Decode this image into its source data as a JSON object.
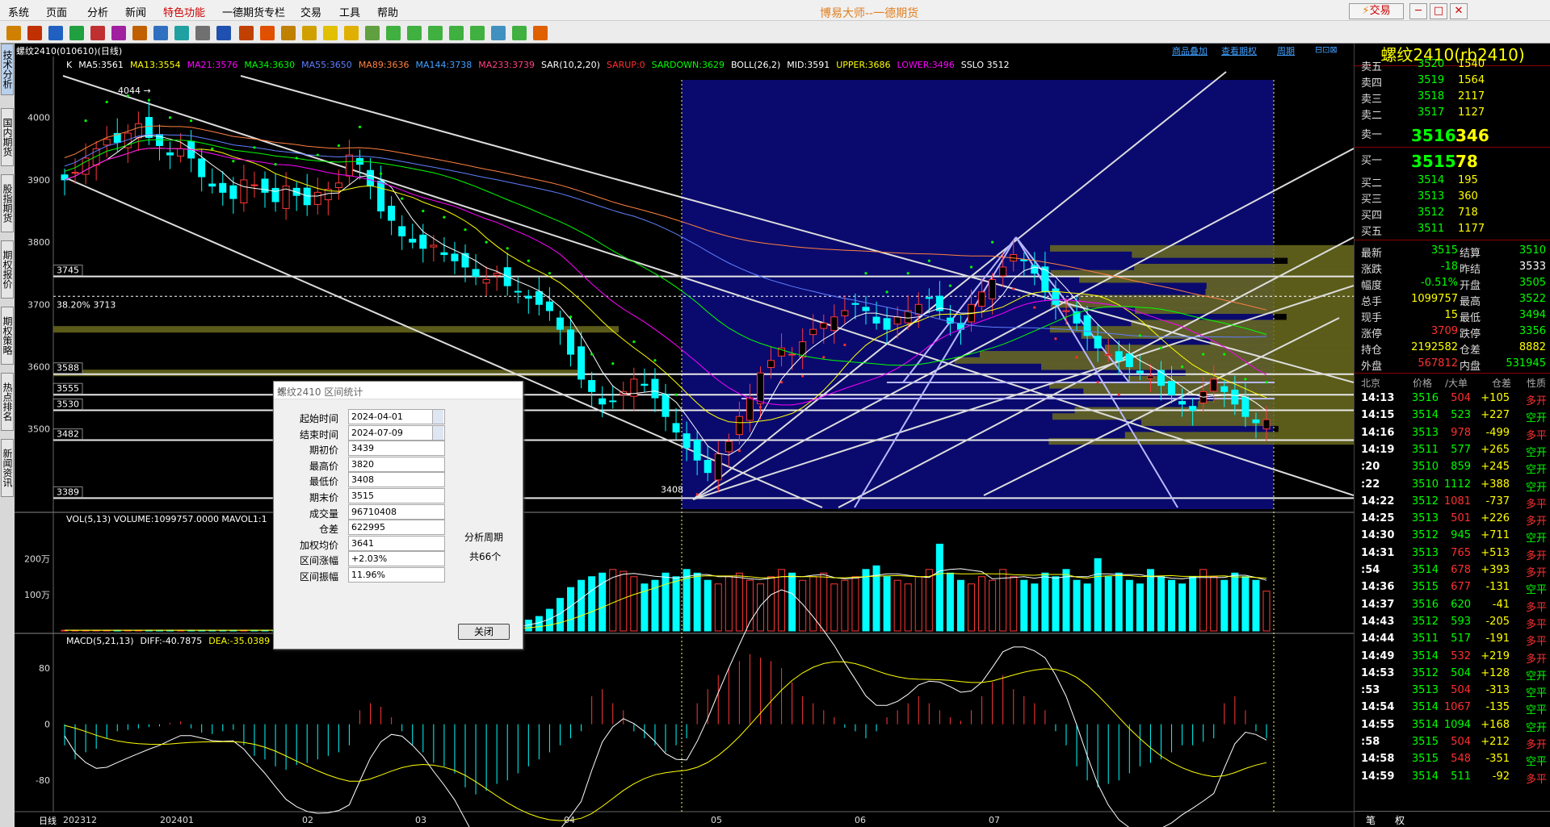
{
  "menu": [
    "系统",
    "页面",
    "分析",
    "新闻",
    "特色功能",
    "一德期货专栏",
    "交易",
    "工具",
    "帮助"
  ],
  "app_title": "博易大师--一德期货",
  "trade_label": "交易",
  "sub_window": "螺纹2410(010610)(日线)",
  "topright_links": [
    "商品叠加",
    "查看期权",
    "周期"
  ],
  "left_tabs": [
    "技术分析",
    "国内期货",
    "股指期货",
    "期权报价",
    "期权策略",
    "热点排名",
    "新闻资讯"
  ],
  "kline_indicators": [
    {
      "text": "K",
      "color": "#ffffff"
    },
    {
      "text": "MA5:3561",
      "color": "#ffffff"
    },
    {
      "text": "MA13:3554",
      "color": "#ffff00"
    },
    {
      "text": "MA21:3576",
      "color": "#ff00ff"
    },
    {
      "text": "MA34:3630",
      "color": "#00ff00"
    },
    {
      "text": "MA55:3650",
      "color": "#5f7fff"
    },
    {
      "text": "MA89:3636",
      "color": "#ff8040"
    },
    {
      "text": "MA144:3738",
      "color": "#40a0ff"
    },
    {
      "text": "MA233:3739",
      "color": "#ff4080"
    },
    {
      "text": "SAR(10,2,20)",
      "color": "#ffffff"
    },
    {
      "text": "SARUP:0",
      "color": "#ff3030"
    },
    {
      "text": "SARDOWN:3629",
      "color": "#00ff00"
    },
    {
      "text": "BOLL(26,2)",
      "color": "#ffffff"
    },
    {
      "text": "MID:3591",
      "color": "#ffffff"
    },
    {
      "text": "UPPER:3686",
      "color": "#ffff00"
    },
    {
      "text": "LOWER:3496",
      "color": "#ff00ff"
    },
    {
      "text": "SSLO 3512",
      "color": "#ffffff"
    }
  ],
  "vol_header": "VOL(5,13) VOLUME:1099757.0000  MAVOL1:1",
  "macd_header_parts": [
    {
      "text": "MACD(5,21,13)",
      "color": "#ffffff"
    },
    {
      "text": "DIFF:-40.7875",
      "color": "#ffffff"
    },
    {
      "text": "DEA:-35.0389",
      "color": "#ffff00"
    },
    {
      "text": "M",
      "color": "#ffffff"
    }
  ],
  "chart_data": [
    {
      "type": "candlestick",
      "name": "K线",
      "y_ticks": [
        4000,
        3900,
        3800,
        3700,
        3600,
        3500
      ],
      "ylim": [
        3370,
        4080
      ],
      "marked_levels": [
        3745,
        3588,
        3555,
        3530,
        3482,
        3389
      ],
      "fib_label": "38.20% 3713",
      "high_label": "4044",
      "low_label": "3408",
      "x_ticks": [
        "202312",
        "202401",
        "02",
        "03",
        "04",
        "05",
        "06",
        "07"
      ],
      "close_series": [
        3900,
        3912,
        3935,
        3950,
        3965,
        3960,
        3975,
        3990,
        3968,
        3955,
        3940,
        3950,
        3935,
        3905,
        3890,
        3880,
        3870,
        3900,
        3892,
        3880,
        3865,
        3890,
        3875,
        3860,
        3880,
        3885,
        3895,
        3940,
        3925,
        3890,
        3850,
        3835,
        3810,
        3800,
        3790,
        3795,
        3780,
        3770,
        3760,
        3745,
        3740,
        3750,
        3730,
        3720,
        3710,
        3700,
        3690,
        3660,
        3620,
        3580,
        3560,
        3540,
        3545,
        3560,
        3580,
        3570,
        3550,
        3520,
        3495,
        3470,
        3450,
        3430,
        3460,
        3480,
        3520,
        3550,
        3590,
        3610,
        3630,
        3620,
        3640,
        3660,
        3670,
        3680,
        3690,
        3700,
        3690,
        3670,
        3660,
        3680,
        3690,
        3700,
        3710,
        3690,
        3670,
        3660,
        3700,
        3720,
        3740,
        3760,
        3780,
        3770,
        3750,
        3720,
        3700,
        3690,
        3670,
        3650,
        3630,
        3620,
        3610,
        3600,
        3590,
        3585,
        3570,
        3555,
        3540,
        3530,
        3560,
        3580,
        3560,
        3540,
        3520,
        3510,
        3515
      ]
    },
    {
      "type": "bar",
      "name": "VOL",
      "y_ticks": [
        "200万",
        "100万"
      ],
      "tick_values": [
        200,
        100
      ],
      "ylim": [
        0,
        290
      ],
      "values": [
        2,
        2,
        2,
        2,
        2,
        2,
        2,
        2,
        2,
        2,
        2,
        2,
        2,
        2,
        2,
        2,
        2,
        2,
        2,
        2,
        2,
        2,
        2,
        2,
        2,
        2,
        2,
        2,
        2,
        2,
        3,
        3,
        3,
        3,
        4,
        4,
        4,
        5,
        6,
        6,
        8,
        10,
        14,
        20,
        30,
        40,
        60,
        90,
        120,
        140,
        150,
        160,
        170,
        165,
        150,
        130,
        140,
        160,
        150,
        170,
        160,
        140,
        130,
        150,
        160,
        140,
        130,
        150,
        170,
        160,
        140,
        150,
        160,
        130,
        140,
        150,
        170,
        180,
        150,
        140,
        130,
        150,
        170,
        240,
        160,
        140,
        130,
        150,
        140,
        170,
        150,
        140,
        130,
        160,
        150,
        170,
        140,
        130,
        200,
        150,
        160,
        140,
        130,
        170,
        150,
        140,
        130,
        150,
        170,
        150,
        140,
        160,
        150,
        140,
        110
      ]
    },
    {
      "type": "bar",
      "name": "MACD",
      "y_ticks": [
        80,
        0,
        -80
      ],
      "ylim": [
        -120,
        110
      ],
      "values": [
        -30,
        -50,
        -40,
        -35,
        -20,
        -10,
        -8,
        -6,
        -4,
        -3,
        2,
        4,
        -6,
        -12,
        -14,
        -10,
        -8,
        -30,
        -45,
        -50,
        -60,
        -65,
        -58,
        -55,
        -50,
        -45,
        -40,
        -30,
        20,
        30,
        25,
        10,
        -10,
        -30,
        -40,
        -55,
        -60,
        -70,
        -90,
        -100,
        -95,
        -85,
        -80,
        -70,
        -60,
        -50,
        -40,
        -30,
        -20,
        -10,
        40,
        50,
        30,
        20,
        -10,
        -20,
        -30,
        -40,
        -30,
        -20,
        30,
        50,
        70,
        80,
        90,
        100,
        95,
        90,
        80,
        60,
        40,
        30,
        20,
        10,
        -5,
        -10,
        -20,
        -10,
        10,
        20,
        30,
        40,
        30,
        20,
        10,
        5,
        20,
        40,
        60,
        70,
        50,
        40,
        30,
        20,
        -10,
        -30,
        -60,
        -80,
        -90,
        -85,
        -80,
        -70,
        -60,
        -55,
        -50,
        -40,
        -30,
        -30,
        -25,
        -20,
        30,
        40,
        20,
        -10,
        -20
      ]
    }
  ],
  "panel": {
    "title": "螺纹2410(rb2410)",
    "asks": [
      {
        "label": "卖五",
        "price": "3520",
        "vol": "1540"
      },
      {
        "label": "卖四",
        "price": "3519",
        "vol": "1564"
      },
      {
        "label": "卖三",
        "price": "3518",
        "vol": "2117"
      },
      {
        "label": "卖二",
        "price": "3517",
        "vol": "1127"
      },
      {
        "label": "卖一",
        "price": "3516",
        "vol": "346"
      }
    ],
    "bids": [
      {
        "label": "买一",
        "price": "3515",
        "vol": "78"
      },
      {
        "label": "买二",
        "price": "3514",
        "vol": "195"
      },
      {
        "label": "买三",
        "price": "3513",
        "vol": "360"
      },
      {
        "label": "买四",
        "price": "3512",
        "vol": "718"
      },
      {
        "label": "买五",
        "price": "3511",
        "vol": "1177"
      }
    ],
    "stats": [
      {
        "l1": "最新",
        "v1": "3515",
        "c1": "#00ff00",
        "l2": "结算",
        "v2": "3510",
        "c2": "#00ff00"
      },
      {
        "l1": "涨跌",
        "v1": "-18",
        "c1": "#00ff00",
        "l2": "昨结",
        "v2": "3533",
        "c2": "#ffffff"
      },
      {
        "l1": "幅度",
        "v1": "-0.51%",
        "c1": "#00ff00",
        "l2": "开盘",
        "v2": "3505",
        "c2": "#00ff00"
      },
      {
        "l1": "总手",
        "v1": "1099757",
        "c1": "#ffff00",
        "l2": "最高",
        "v2": "3522",
        "c2": "#00ff00"
      },
      {
        "l1": "现手",
        "v1": "15",
        "c1": "#ffff00",
        "l2": "最低",
        "v2": "3494",
        "c2": "#00ff00"
      },
      {
        "l1": "涨停",
        "v1": "3709",
        "c1": "#ff3030",
        "l2": "跌停",
        "v2": "3356",
        "c2": "#00ff00"
      },
      {
        "l1": "持仓",
        "v1": "2192582",
        "c1": "#ffff00",
        "l2": "仓差",
        "v2": "8882",
        "c2": "#ffff00"
      },
      {
        "l1": "外盘",
        "v1": "567812",
        "c1": "#ff3030",
        "l2": "内盘",
        "v2": "531945",
        "c2": "#00ff00"
      }
    ],
    "tick_headers": [
      "北京",
      "价格",
      "∕大单",
      "仓差",
      "性质"
    ],
    "ticks": [
      {
        "t": "14:13",
        "p": "3516",
        "v": "504",
        "d": "+105",
        "n": "多开",
        "vc": "#ff3030",
        "nc": "#ff3030"
      },
      {
        "t": "14:15",
        "p": "3514",
        "v": "523",
        "d": "+227",
        "n": "空开",
        "vc": "#00ff00",
        "nc": "#00ff00"
      },
      {
        "t": "14:16",
        "p": "3513",
        "v": "978",
        "d": "-499",
        "n": "多平",
        "vc": "#ff3030",
        "nc": "#ff3030"
      },
      {
        "t": "14:19",
        "p": "3511",
        "v": "577",
        "d": "+265",
        "n": "空开",
        "vc": "#00ff00",
        "nc": "#00ff00"
      },
      {
        "t": ":20",
        "p": "3510",
        "v": "859",
        "d": "+245",
        "n": "空开",
        "vc": "#00ff00",
        "nc": "#00ff00"
      },
      {
        "t": ":22",
        "p": "3510",
        "v": "1112",
        "d": "+388",
        "n": "空开",
        "vc": "#00ff00",
        "nc": "#00ff00"
      },
      {
        "t": "14:22",
        "p": "3512",
        "v": "1081",
        "d": "-737",
        "n": "多平",
        "vc": "#ff3030",
        "nc": "#ff3030"
      },
      {
        "t": "14:25",
        "p": "3513",
        "v": "501",
        "d": "+226",
        "n": "多开",
        "vc": "#ff3030",
        "nc": "#ff3030"
      },
      {
        "t": "14:30",
        "p": "3512",
        "v": "945",
        "d": "+711",
        "n": "空开",
        "vc": "#00ff00",
        "nc": "#00ff00"
      },
      {
        "t": "14:31",
        "p": "3513",
        "v": "765",
        "d": "+513",
        "n": "多开",
        "vc": "#ff3030",
        "nc": "#ff3030"
      },
      {
        "t": ":54",
        "p": "3514",
        "v": "678",
        "d": "+393",
        "n": "多开",
        "vc": "#ff3030",
        "nc": "#ff3030"
      },
      {
        "t": "14:36",
        "p": "3515",
        "v": "677",
        "d": "-131",
        "n": "空平",
        "vc": "#ff3030",
        "nc": "#00ff00"
      },
      {
        "t": "14:37",
        "p": "3516",
        "v": "620",
        "d": "-41",
        "n": "多平",
        "vc": "#00ff00",
        "nc": "#ff3030"
      },
      {
        "t": "14:43",
        "p": "3512",
        "v": "593",
        "d": "-205",
        "n": "多平",
        "vc": "#00ff00",
        "nc": "#ff3030"
      },
      {
        "t": "14:44",
        "p": "3511",
        "v": "517",
        "d": "-191",
        "n": "多平",
        "vc": "#00ff00",
        "nc": "#ff3030"
      },
      {
        "t": "14:49",
        "p": "3514",
        "v": "532",
        "d": "+219",
        "n": "多开",
        "vc": "#ff3030",
        "nc": "#ff3030"
      },
      {
        "t": "14:53",
        "p": "3512",
        "v": "504",
        "d": "+128",
        "n": "空开",
        "vc": "#00ff00",
        "nc": "#00ff00"
      },
      {
        "t": ":53",
        "p": "3513",
        "v": "504",
        "d": "-313",
        "n": "空平",
        "vc": "#ff3030",
        "nc": "#00ff00"
      },
      {
        "t": "14:54",
        "p": "3514",
        "v": "1067",
        "d": "-135",
        "n": "空平",
        "vc": "#ff3030",
        "nc": "#00ff00"
      },
      {
        "t": "14:55",
        "p": "3514",
        "v": "1094",
        "d": "+168",
        "n": "空开",
        "vc": "#00ff00",
        "nc": "#00ff00"
      },
      {
        "t": ":58",
        "p": "3515",
        "v": "504",
        "d": "+212",
        "n": "多开",
        "vc": "#ff3030",
        "nc": "#ff3030"
      },
      {
        "t": "14:58",
        "p": "3515",
        "v": "548",
        "d": "-351",
        "n": "空平",
        "vc": "#ff3030",
        "nc": "#00ff00"
      },
      {
        "t": "14:59",
        "p": "3514",
        "v": "511",
        "d": "-92",
        "n": "多平",
        "vc": "#00ff00",
        "nc": "#ff3030"
      }
    ],
    "bottom_tabs": [
      "笔",
      "权"
    ]
  },
  "dialog": {
    "title": "螺纹2410 区间统计",
    "fields": [
      {
        "label": "起始时间",
        "value": "2024-04-01"
      },
      {
        "label": "结束时间",
        "value": "2024-07-09"
      },
      {
        "label": "期初价",
        "value": "3439"
      },
      {
        "label": "最高价",
        "value": "3820"
      },
      {
        "label": "最低价",
        "value": "3408"
      },
      {
        "label": "期末价",
        "value": "3515"
      },
      {
        "label": "成交量",
        "value": "96710408"
      },
      {
        "label": "仓差",
        "value": "622995"
      },
      {
        "label": "加权均价",
        "value": "3641"
      },
      {
        "label": "区间涨幅",
        "value": "+2.03%"
      },
      {
        "label": "区间振幅",
        "value": "11.96%"
      }
    ],
    "period_label": "分析周期",
    "period_count": "共66个",
    "close_label": "关闭"
  },
  "bottom_axis_label": "日线"
}
